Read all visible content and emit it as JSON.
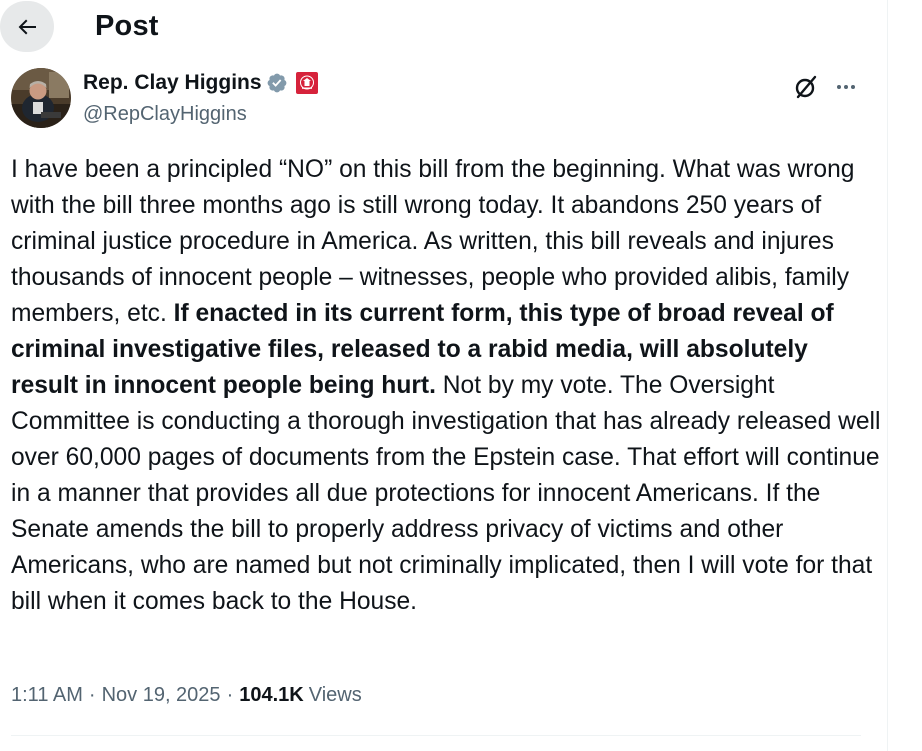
{
  "header": {
    "title": "Post"
  },
  "author": {
    "display_name": "Rep. Clay Higgins",
    "handle": "@RepClayHiggins"
  },
  "post": {
    "text_part1": "I have been a principled “NO” on this bill from the beginning. What was wrong with the bill three months ago is still wrong today. It abandons 250 years of criminal justice procedure in America. As written, this bill reveals and injures thousands of innocent people – witnesses, people who provided alibis, family members, etc. ",
    "text_bold": "If enacted in its current form, this type of broad reveal of criminal investigative files, released to a rabid media, will absolutely result in innocent people being hurt.",
    "text_part2": " Not by my vote. The Oversight Committee is conducting a thorough investigation that has already released well over 60,000 pages of documents from the Epstein case. That effort will continue in a manner that provides all due protections for innocent Americans. If the Senate amends the bill to properly address privacy of victims and other Americans, who are named but not criminally implicated, then I will vote for that bill when it comes back to the House."
  },
  "meta": {
    "time": "1:11 AM",
    "separator": "·",
    "date": "Nov 19, 2025",
    "views_count": "104.1K",
    "views_label": "Views"
  },
  "icons": {
    "back": "arrow-left-icon",
    "verified": "verified-badge-icon",
    "affiliation": "house-of-representatives-seal-icon",
    "grok": "grok-icon",
    "more": "more-options-icon"
  },
  "colors": {
    "text_primary": "#0f1419",
    "text_secondary": "#536471",
    "back_button_bg": "#e7e9ea",
    "verified_badge": "#829aab",
    "affiliation_badge": "#d6223b",
    "divider": "#eff3f4"
  }
}
